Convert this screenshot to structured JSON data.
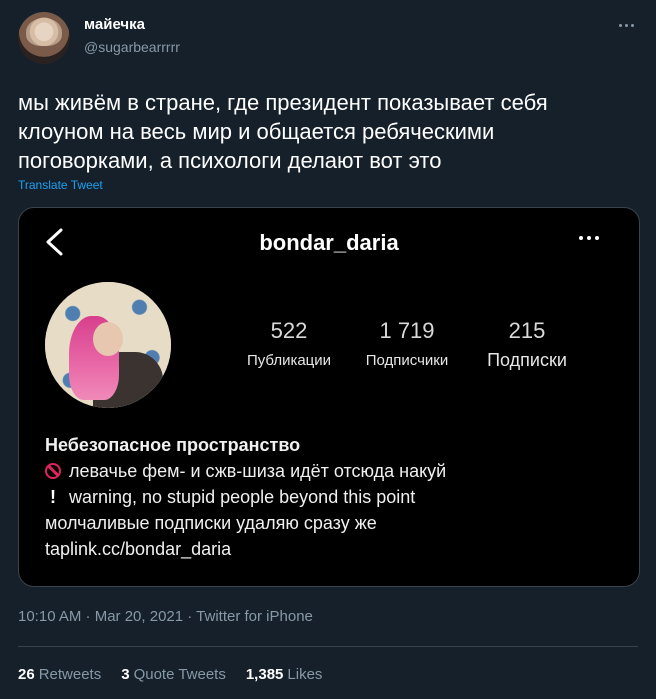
{
  "author": {
    "display_name": "майечка",
    "handle": "@sugarbearrrrr"
  },
  "tweet": {
    "text": "мы живём в стране, где президент показывает себя\nклоуном на весь мир и общается ребяческими\nпоговорками, а психологи делают вот это",
    "translate_label": "Translate Tweet",
    "timestamp": "10:10 AM · Mar 20, 2021 · Twitter for iPhone"
  },
  "media": {
    "username": "bondar_daria",
    "stats": [
      {
        "value": "522",
        "label": "Публикации"
      },
      {
        "value": "1 719",
        "label": "Подписчики"
      },
      {
        "value": "215",
        "label": "Подписки"
      }
    ],
    "bio": {
      "title": "Небезопасное пространство",
      "line1": "левачье фем- и сжв-шиза идёт отсюда накуй",
      "line2": "warning, no stupid people beyond this point",
      "line3": "молчаливые подписки удаляю сразу же",
      "link": "taplink.cc/bondar_daria"
    }
  },
  "engagement": {
    "retweets_count": "26",
    "retweets_label": "Retweets",
    "quotes_count": "3",
    "quotes_label": "Quote Tweets",
    "likes_count": "1,385",
    "likes_label": "Likes"
  },
  "icons": [
    "more-icon",
    "back-chevron-icon",
    "prohibited-icon",
    "exclamation-icon"
  ],
  "colors": {
    "background": "#15202b",
    "link": "#1da1f2",
    "muted": "#8899a6",
    "media_bg": "#000000",
    "prohibit": "#e0245e"
  }
}
